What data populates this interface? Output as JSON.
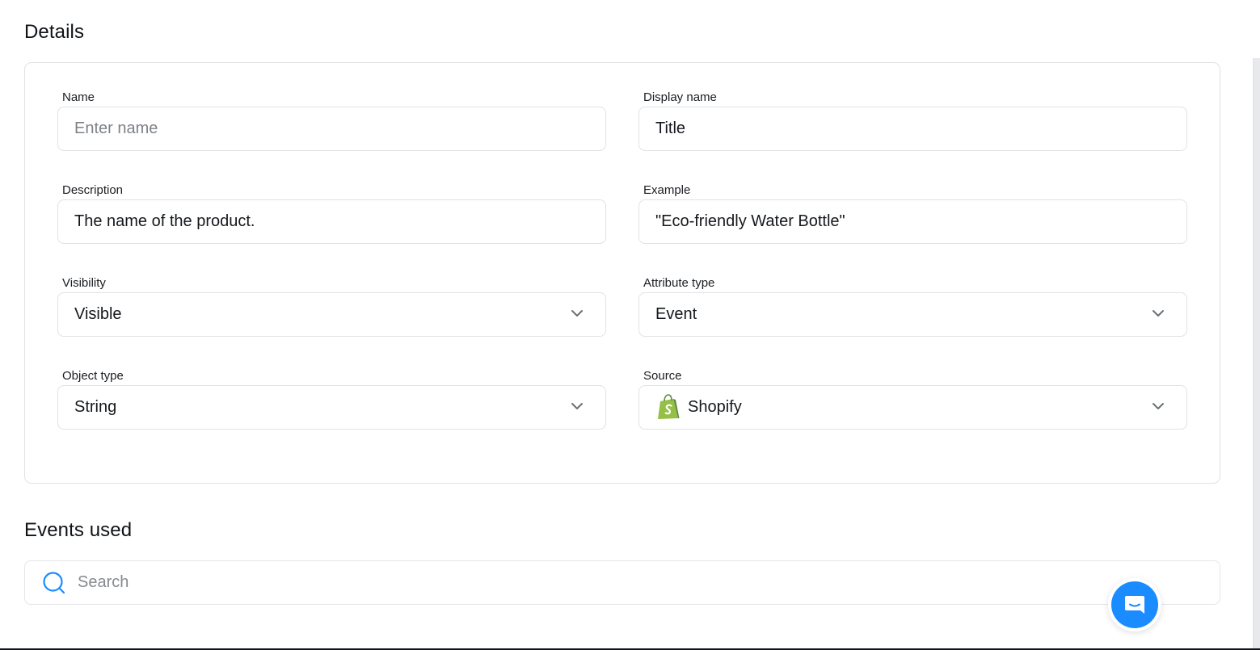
{
  "details": {
    "title": "Details",
    "fields": {
      "name": {
        "label": "Name",
        "value": "",
        "placeholder": "Enter name"
      },
      "display_name": {
        "label": "Display name",
        "value": "Title"
      },
      "description": {
        "label": "Description",
        "value": "The name of the product."
      },
      "example": {
        "label": "Example",
        "value": "\"Eco-friendly Water Bottle\""
      },
      "visibility": {
        "label": "Visibility",
        "value": "Visible"
      },
      "attribute_type": {
        "label": "Attribute type",
        "value": "Event"
      },
      "object_type": {
        "label": "Object type",
        "value": "String"
      },
      "source": {
        "label": "Source",
        "value": "Shopify",
        "icon": "shopify-icon"
      }
    }
  },
  "events_used": {
    "title": "Events used",
    "search": {
      "placeholder": "Search",
      "value": "",
      "icon": "search-icon"
    }
  },
  "chat_launcher": {
    "icon": "chat-icon"
  },
  "colors": {
    "accent": "#1a8cff",
    "border": "#dfe2e6",
    "placeholder": "#7d8288",
    "shopify_green": "#95bf47"
  }
}
